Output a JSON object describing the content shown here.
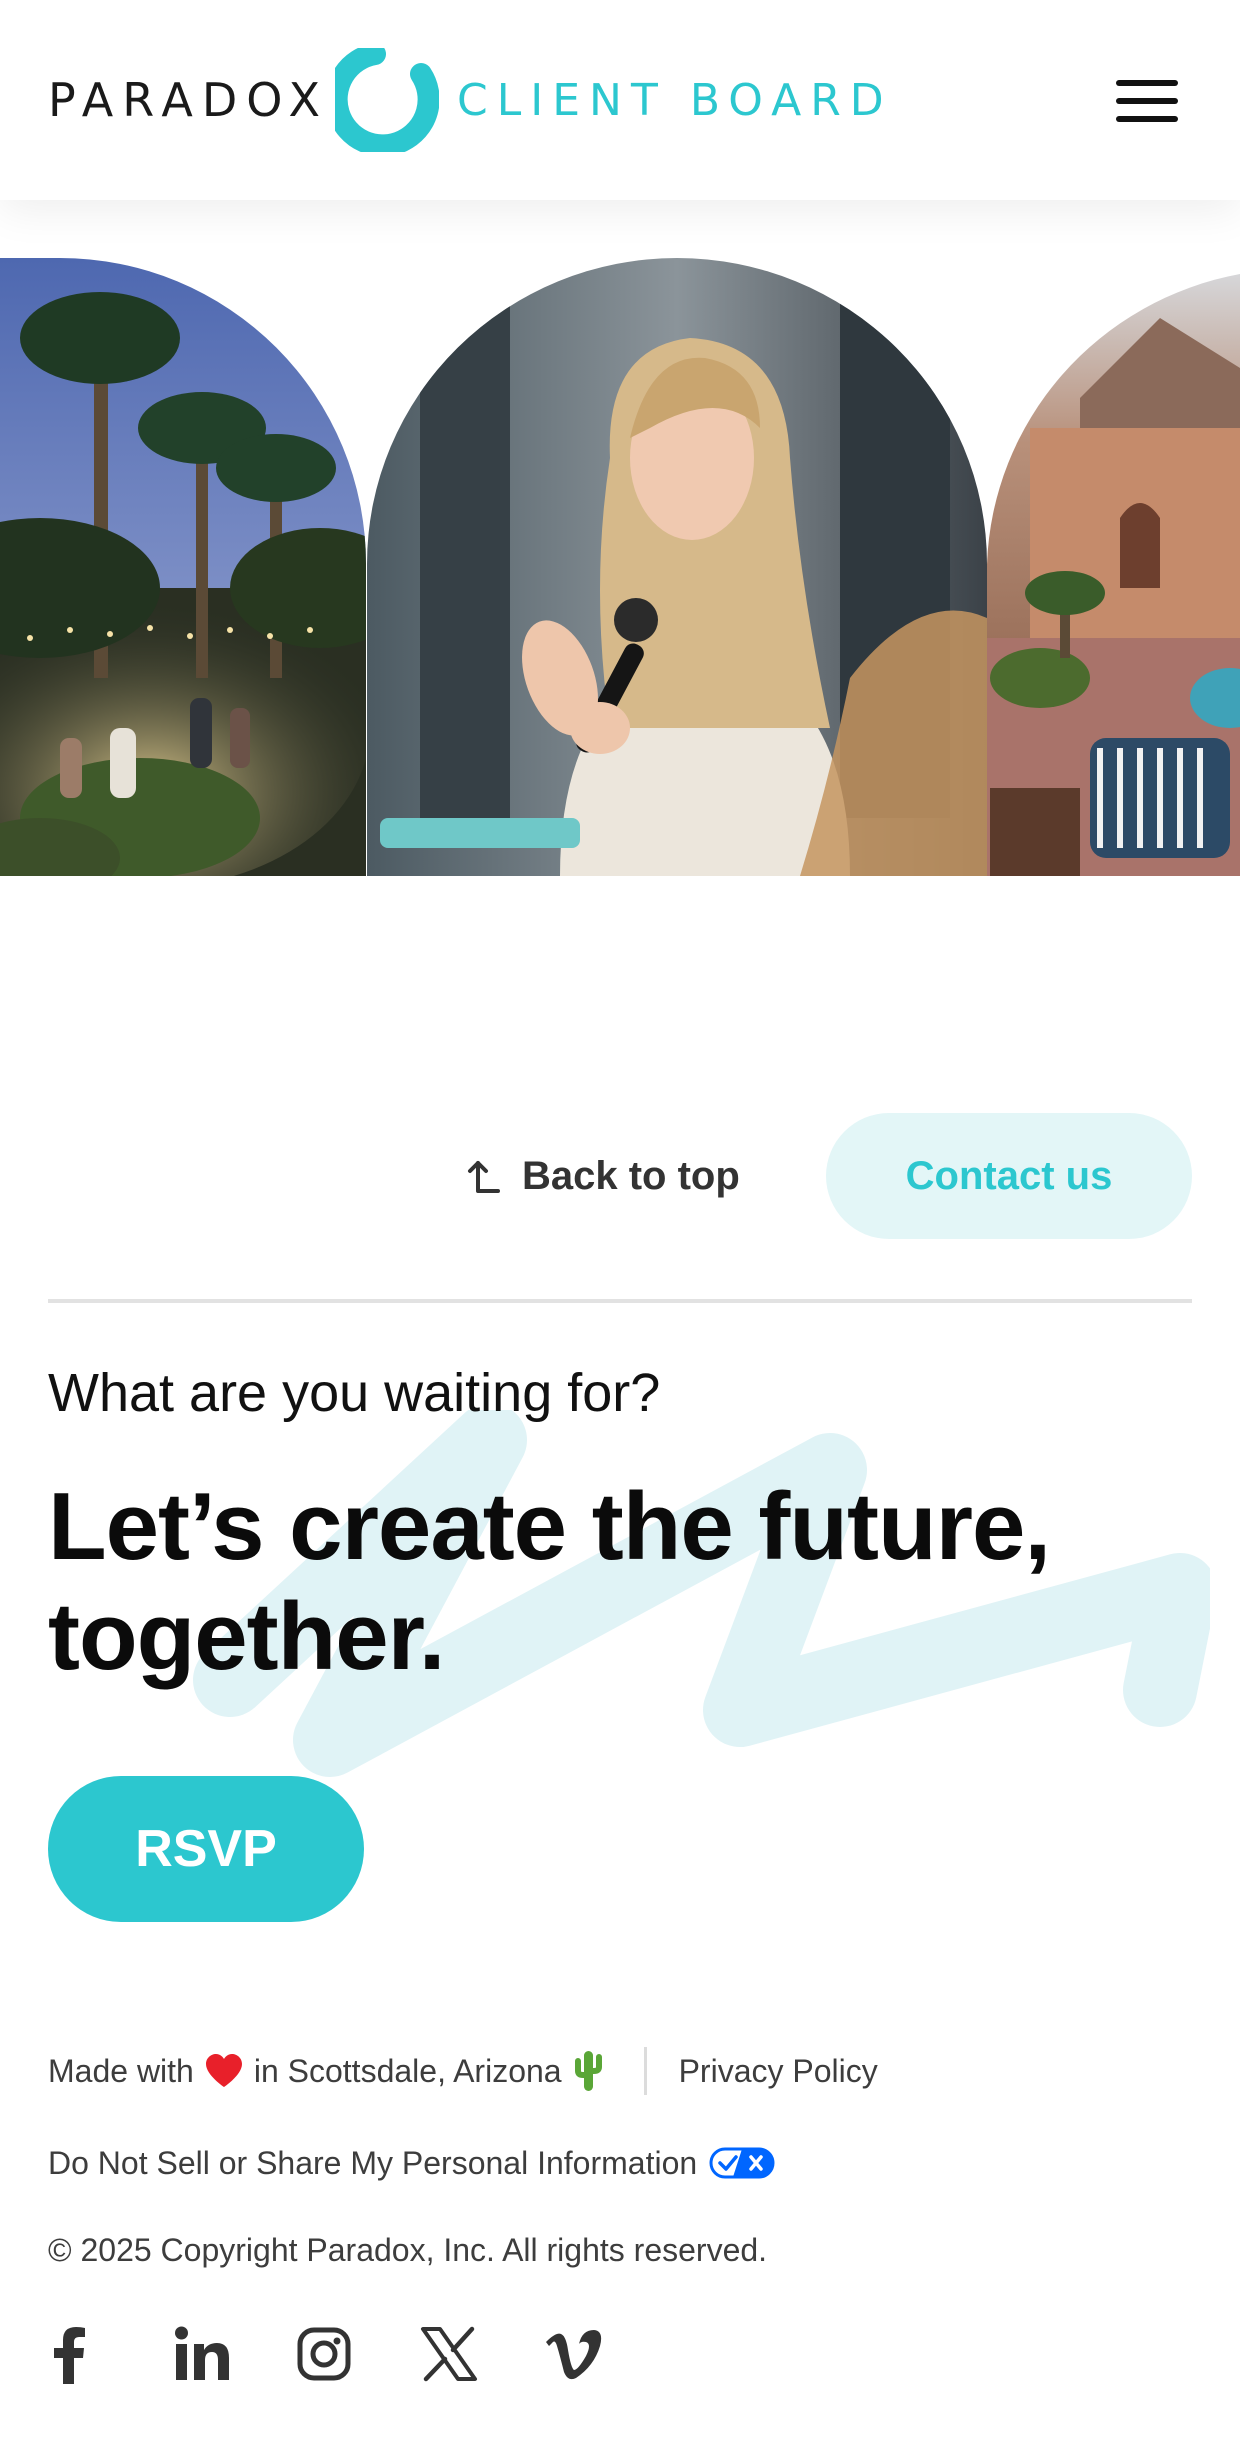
{
  "header": {
    "brand": "PARADOX",
    "brand_sub": "CLIENT BOARD",
    "menu_icon": "hamburger-menu-icon"
  },
  "gallery": {
    "photos": [
      {
        "name": "palm-garden-evening-event-photo"
      },
      {
        "name": "speaker-with-microphone-photo"
      },
      {
        "name": "resort-courtyard-pool-photo"
      }
    ]
  },
  "nav": {
    "back_to_top": "Back to top",
    "back_to_top_icon": "arrow-up-icon",
    "contact": "Contact us"
  },
  "cta": {
    "eyebrow": "What are you waiting for?",
    "headline": "Let’s create the future, together.",
    "button": "RSVP"
  },
  "footer": {
    "made_prefix": "Made with",
    "made_heart": "❤️",
    "made_suffix": "in Scottsdale, Arizona",
    "made_cactus": "🌵",
    "privacy": "Privacy Policy",
    "dns": "Do Not Sell or Share My Personal Information",
    "copyright": "© 2025 Copyright Paradox, Inc. All rights reserved.",
    "social": [
      "facebook-icon",
      "linkedin-icon",
      "instagram-icon",
      "x-twitter-icon",
      "vimeo-icon"
    ]
  },
  "colors": {
    "accent": "#2cc7cf",
    "accent_light": "#e3f6f7",
    "text": "#1a1a1a"
  }
}
